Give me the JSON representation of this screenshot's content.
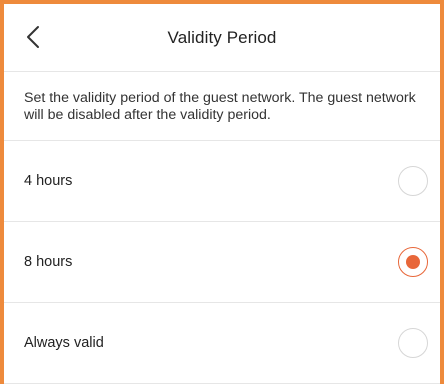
{
  "header": {
    "title": "Validity Period",
    "back_icon": "chevron-left-icon"
  },
  "description": "Set the validity period of the guest network. The guest network will be disabled after the validity period.",
  "options": [
    {
      "label": "4 hours",
      "selected": false
    },
    {
      "label": "8 hours",
      "selected": true
    },
    {
      "label": "Always valid",
      "selected": false
    }
  ],
  "colors": {
    "accent": "#e8673a",
    "frame": "#ee8a3c"
  }
}
